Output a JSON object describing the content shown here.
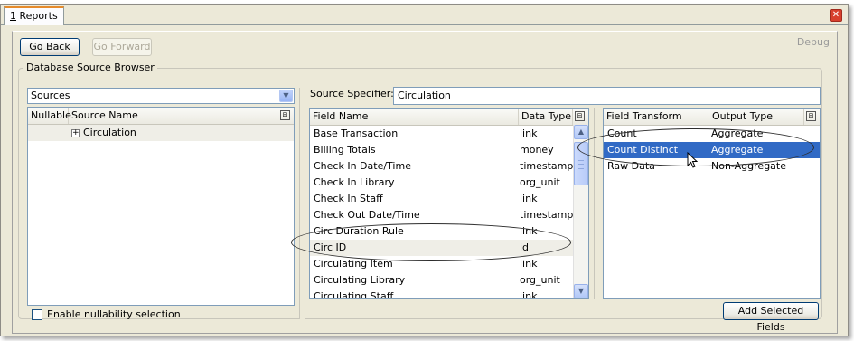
{
  "tab": {
    "number": "1",
    "label": " Reports"
  },
  "toolbar": {
    "go_back": "Go Back",
    "go_forward": "Go Forward",
    "debug": "Debug"
  },
  "browser": {
    "title": "Database Source Browser",
    "sources_combo": "Sources",
    "columns": [
      "Nullable",
      "Source Name"
    ],
    "tree": [
      {
        "name": "Circulation",
        "expander": "+"
      }
    ],
    "enable_nullability": "Enable nullability selection"
  },
  "specifier": {
    "label": "Source Specifier:",
    "value": "Circulation"
  },
  "fields": {
    "columns": [
      "Field Name",
      "Data Type"
    ],
    "rows": [
      {
        "name": "Base Transaction",
        "type": "link"
      },
      {
        "name": "Billing Totals",
        "type": "money"
      },
      {
        "name": "Check In Date/Time",
        "type": "timestamp"
      },
      {
        "name": "Check In Library",
        "type": "org_unit"
      },
      {
        "name": "Check In Staff",
        "type": "link"
      },
      {
        "name": "Check Out Date/Time",
        "type": "timestamp"
      },
      {
        "name": "Circ Duration Rule",
        "type": "link"
      },
      {
        "name": "Circ ID",
        "type": "id"
      },
      {
        "name": "Circulating Item",
        "type": "link"
      },
      {
        "name": "Circulating Library",
        "type": "org_unit"
      },
      {
        "name": "Circulating Staff",
        "type": "link"
      }
    ]
  },
  "transforms": {
    "columns": [
      "Field Transform",
      "Output Type"
    ],
    "rows": [
      {
        "name": "Count",
        "type": "Aggregate"
      },
      {
        "name": "Count Distinct",
        "type": "Aggregate"
      },
      {
        "name": "Raw Data",
        "type": "Non-Aggregate"
      }
    ],
    "add_button": "Add Selected Fields"
  }
}
